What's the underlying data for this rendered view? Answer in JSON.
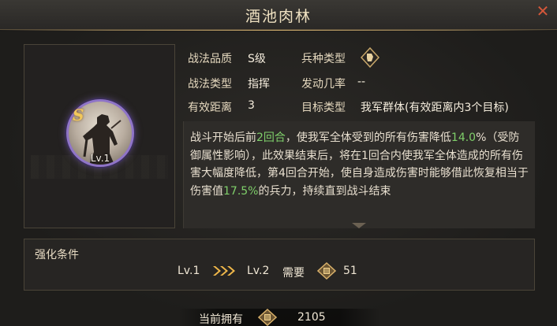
{
  "header": {
    "title": "酒池肉林",
    "close_icon": "close-x-icon"
  },
  "skill": {
    "grade": "S",
    "level": "Lv.1",
    "ring_color": "#8f74c8"
  },
  "attributes": {
    "quality_label": "战法品质",
    "quality_value": "S级",
    "troop_label": "兵种类型",
    "troop_icon": "troop-type-icon",
    "type_label": "战法类型",
    "type_value": "指挥",
    "rate_label": "发动几率",
    "rate_value": "--",
    "range_label": "有效距离",
    "range_value": "3",
    "target_label": "目标类型",
    "target_value": "我军群体(有效距离内3个目标)"
  },
  "description": {
    "p1": "战斗开始后前",
    "h1": "2回合",
    "p2": "，使我军全体受到的所有伤害降低",
    "h2": "14.0",
    "p3": "%（受防御属性影响），此效果结束后，将在1回合内使我军全体造成的所有伤害大幅度降低，第4回合开始，使自身造成伤害时能够借此恢复相当于伤害值",
    "h3": "17.5%",
    "p4": "的兵力，持续直到战斗结束",
    "highlight_color": "#7fcf6a"
  },
  "enhance": {
    "title": "强化条件",
    "from_level": "Lv.1",
    "to_level": "Lv.2",
    "need_label": "需要",
    "need_value": "51",
    "currency_icon": "skill-point-coin-icon"
  },
  "owned": {
    "label": "当前拥有",
    "value": "2105"
  }
}
